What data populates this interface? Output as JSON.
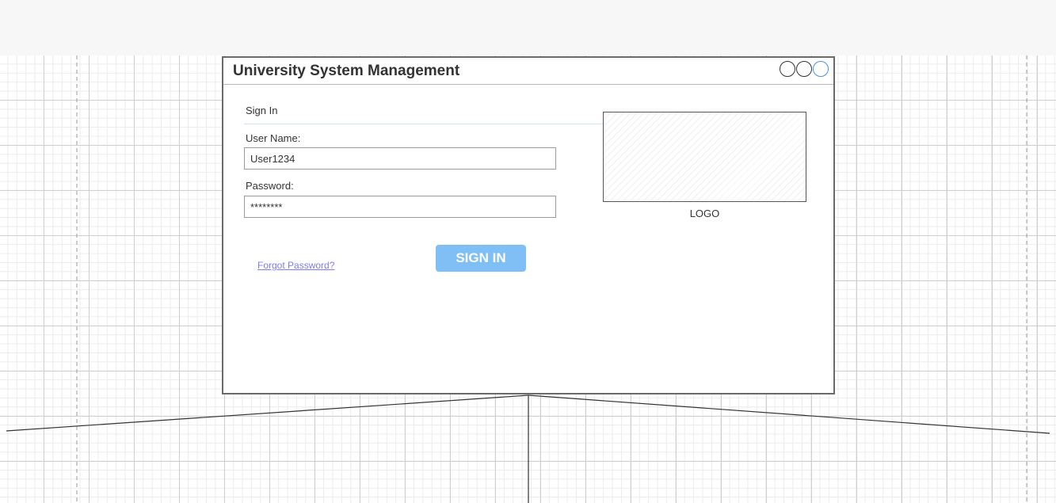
{
  "window": {
    "title": "University System Management",
    "controls": [
      "circle-button",
      "circle-button",
      "circle-button-active"
    ]
  },
  "form": {
    "section_label": "Sign In",
    "username_label": "User Name:",
    "username_value": "User1234",
    "password_label": "Password:",
    "password_value": "********",
    "forgot_link": "Forgot Password?",
    "signin_label": "SIGN IN"
  },
  "logo": {
    "caption": "LOGO"
  },
  "colors": {
    "accent": "#7fbff5",
    "link": "#7c7cf0",
    "active_control": "#4a90e2"
  }
}
